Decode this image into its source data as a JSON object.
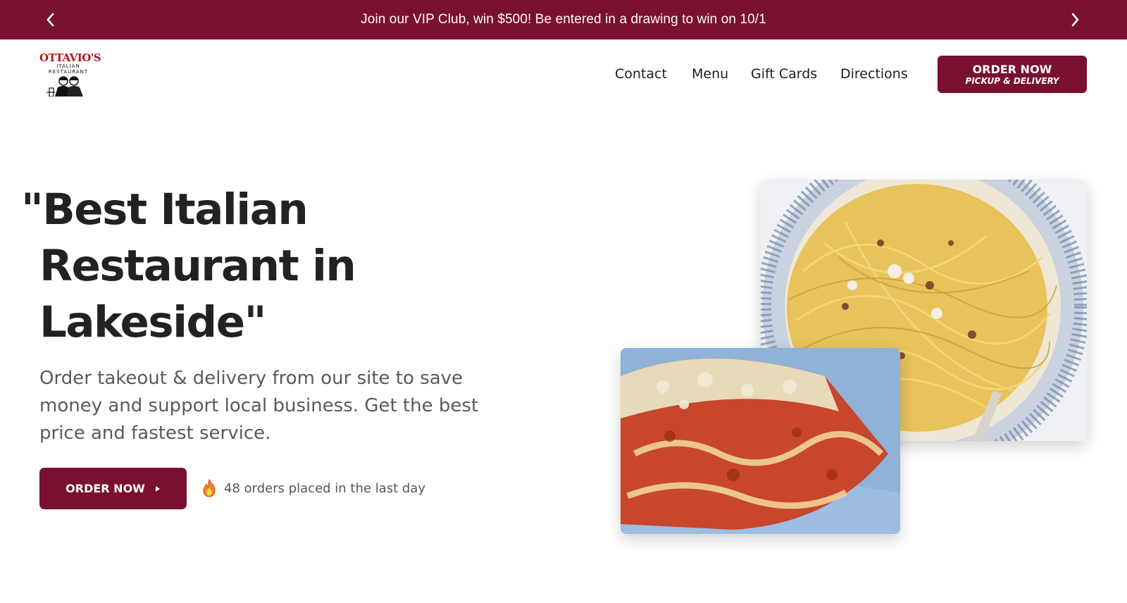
{
  "announcement": {
    "text": "Join our VIP Club, win $500! Be entered in a drawing to win on 10/1",
    "prev_icon": "chevron-left-icon",
    "next_icon": "chevron-right-icon"
  },
  "brand": {
    "logo_title": "OTTAVIO'S",
    "logo_subtitle_1": "ITALIAN",
    "logo_subtitle_2": "RESTAURANT",
    "accent_color": "#7a1030"
  },
  "nav": {
    "items": [
      {
        "label": "Contact"
      },
      {
        "label": "Menu"
      },
      {
        "label": "Gift Cards"
      },
      {
        "label": "Directions"
      }
    ],
    "order_button": {
      "label": "ORDER NOW",
      "sublabel": "PICKUP & DELIVERY"
    }
  },
  "hero": {
    "title_line_1": "\"Best Italian",
    "title_line_2": "Restaurant in",
    "title_line_3": "Lakeside\"",
    "description": "Order takeout & delivery from our site to save money and support local business. Get the best price and fastest service.",
    "cta_label": "ORDER NOW",
    "stat_icon": "fire-icon",
    "stat_text": "48 orders placed in the last day"
  }
}
